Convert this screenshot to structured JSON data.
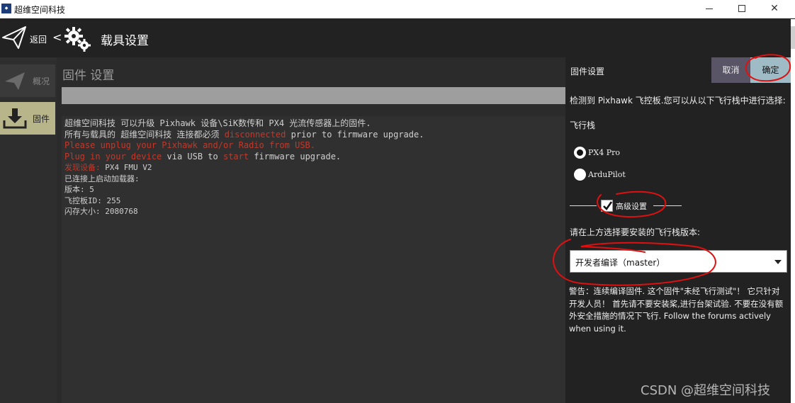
{
  "window": {
    "title": "超维空间科技",
    "icon": "app-logo-icon",
    "controls": [
      "minimize-icon",
      "maximize-icon",
      "close-icon"
    ]
  },
  "header": {
    "back_label": "返回",
    "separator": "<",
    "page_title": "载具设置",
    "icons": [
      "paper-plane-icon",
      "gears-icon"
    ]
  },
  "nav": {
    "items": [
      {
        "label": "概况",
        "icon": "plane-icon",
        "selected": false
      },
      {
        "label": "固件",
        "icon": "download-icon",
        "selected": true
      }
    ]
  },
  "firmware": {
    "section_title": "固件 设置",
    "progress": 0,
    "log": {
      "line1": "超维空间科技 可以升级 Pixhawk 设备\\SiK数传和 PX4 光流传感器上的固件.",
      "line2_a": "所有与载具的 超维空间科技 连接都必须 ",
      "line2_b": "disconnected",
      "line2_c": " prior to firmware upgrade.",
      "line3": "Please unplug your Pixhawk and/or Radio from USB.",
      "line4_a": "Plug in your device",
      "line4_b": " via USB to ",
      "line4_c": "start",
      "line4_d": " firmware upgrade.",
      "line5_a": "发现设备: ",
      "line5_b": "PX4 FMU V2",
      "line6": "已连接上启动加载器:",
      "line7": "版本:  5",
      "line8": "飞控板ID: 255",
      "line9": "闪存大小:  2080768"
    }
  },
  "panel": {
    "title": "固件设置",
    "cancel_label": "取消",
    "ok_label": "确定",
    "detect_text": "检测到 Pixhawk 飞控板.您可以从以下飞行栈中进行选择:",
    "stack_label": "飞行栈",
    "stacks": [
      {
        "label": "PX4 Pro",
        "selected": true
      },
      {
        "label": "ArduPilot",
        "selected": false
      }
    ],
    "advanced_label": "高级设置",
    "advanced_checked": true,
    "choose_label": "请在上方选择要安装的飞行栈版本:",
    "version_selected": "开发者编译（master）",
    "warning_text": "警告：连续编译固件. 这个固件\"未经飞行测试\"！ 它只针对开发人员！ 首先请不要安装桨,进行台架试验. 不要在没有额外安全措施的情况下飞行. Follow the forums actively when using it."
  },
  "watermark": "CSDN @超维空间科技",
  "colors": {
    "background": "#2b2b2b",
    "header": "#222222",
    "nav_selected": "#b9b58b",
    "ok_button": "#9fbcc6",
    "cancel_button": "#595466",
    "log_red": "#c0392b",
    "annotation": "#e01010"
  }
}
